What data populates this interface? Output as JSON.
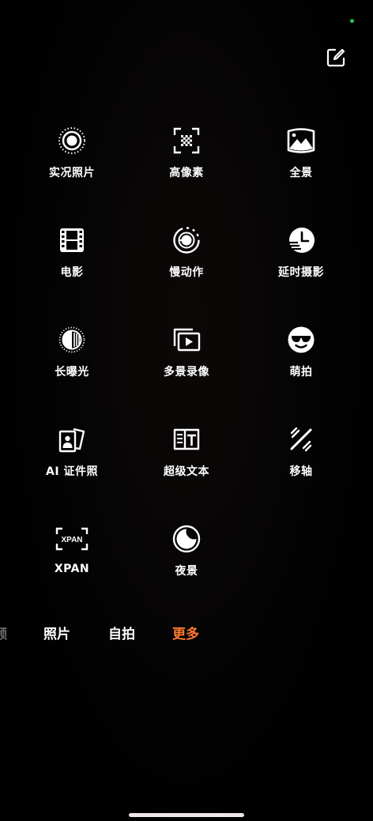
{
  "modes": [
    {
      "id": "live-photo",
      "label": "实况照片",
      "icon": "live-photo-icon"
    },
    {
      "id": "high-res",
      "label": "高像素",
      "icon": "high-resolution-icon"
    },
    {
      "id": "panorama",
      "label": "全景",
      "icon": "panorama-icon"
    },
    {
      "id": "movie",
      "label": "电影",
      "icon": "film-icon"
    },
    {
      "id": "slow-motion",
      "label": "慢动作",
      "icon": "slow-motion-icon"
    },
    {
      "id": "time-lapse",
      "label": "延时摄影",
      "icon": "time-lapse-icon"
    },
    {
      "id": "long-exposure",
      "label": "长曝光",
      "icon": "long-exposure-icon"
    },
    {
      "id": "multi-view",
      "label": "多景录像",
      "icon": "multi-view-video-icon"
    },
    {
      "id": "cute",
      "label": "萌拍",
      "icon": "sunglasses-face-icon"
    },
    {
      "id": "id-photo",
      "label": "AI 证件照",
      "icon": "id-photo-icon"
    },
    {
      "id": "super-text",
      "label": "超级文本",
      "icon": "document-text-icon"
    },
    {
      "id": "tilt-shift",
      "label": "移轴",
      "icon": "tilt-shift-icon"
    },
    {
      "id": "xpan",
      "label": "XPAN",
      "icon": "xpan-icon",
      "icon_text": "XPAN"
    },
    {
      "id": "night",
      "label": "夜景",
      "icon": "night-mode-icon"
    }
  ],
  "tabs": {
    "partial": "频",
    "photo": "照片",
    "selfie": "自拍",
    "more": "更多",
    "active": "more"
  },
  "colors": {
    "accent": "#ff7a2e",
    "status_dot": "#27c251"
  }
}
